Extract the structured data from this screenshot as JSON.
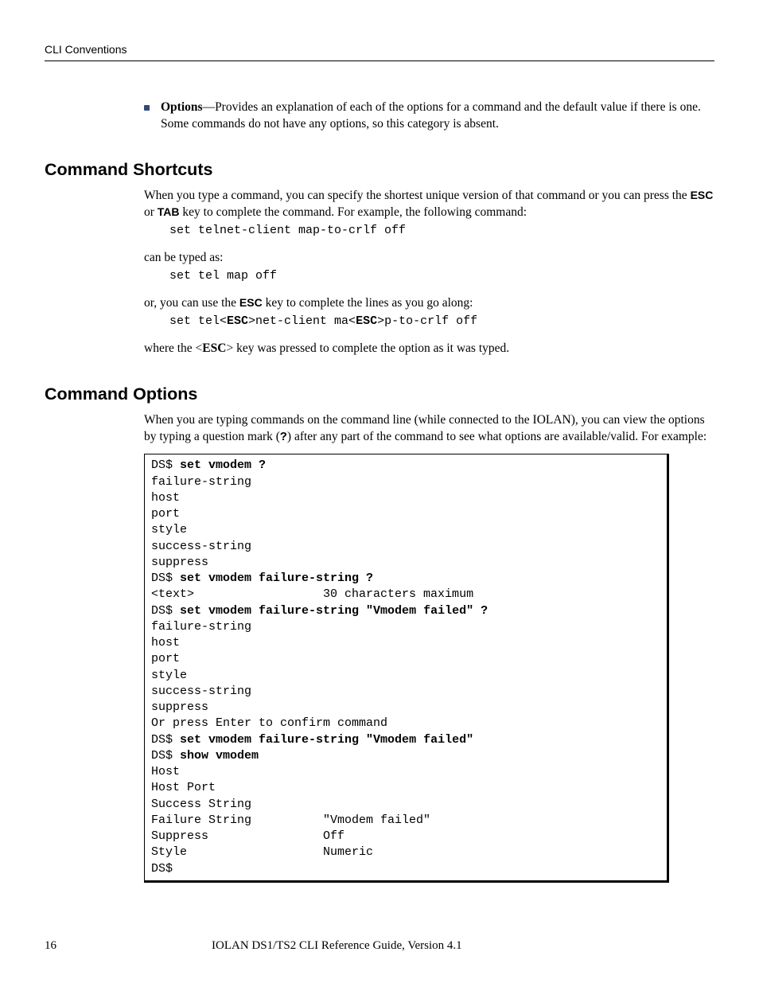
{
  "header": {
    "title": "CLI Conventions"
  },
  "bullet": {
    "label": "Options",
    "text": "—Provides an explanation of each of the options for a command and the default value if there is one. Some commands do not have any options, so this category is absent."
  },
  "section1": {
    "heading": "Command Shortcuts",
    "para1_a": "When you type a command, you can specify the shortest unique version of that command or you can press the ",
    "key_esc": "ESC",
    "para1_b": " or ",
    "key_tab": "TAB",
    "para1_c": " key to complete the command. For example, the following command:",
    "code1": "set telnet-client map-to-crlf off",
    "para2": "can be typed as:",
    "code2": "set tel map off",
    "para3_a": "or, you can use the ",
    "para3_b": " key to complete the lines as you go along:",
    "code3_a": "set tel<",
    "code3_b": ">net-client ma<",
    "code3_c": ">p-to-crlf off",
    "para4_a": "where the <",
    "para4_b": "> key was pressed to complete the option as it was typed.",
    "esc_bold": "ESC"
  },
  "section2": {
    "heading": "Command Options",
    "para_a": "When you are typing commands on the command line (while connected to the IOLAN), you can view the options by typing a question mark (",
    "qmark": "?",
    "para_b": ") after any part of the command to see what options are available/valid. For example:"
  },
  "example": {
    "l01a": "DS$ ",
    "l01b": "set vmodem ?",
    "l02": "failure-string",
    "l03": "host",
    "l04": "port",
    "l05": "style",
    "l06": "success-string",
    "l07": "suppress",
    "l08a": "DS$ ",
    "l08b": "set vmodem failure-string ?",
    "l09": "<text>                  30 characters maximum",
    "l10a": "DS$ ",
    "l10b": "set vmodem failure-string \"Vmodem failed\" ?",
    "l11": "failure-string",
    "l12": "host",
    "l13": "port",
    "l14": "style",
    "l15": "success-string",
    "l16": "suppress",
    "l17": "Or press Enter to confirm command",
    "l18a": "DS$ ",
    "l18b": "set vmodem failure-string \"Vmodem failed\"",
    "l19a": "DS$ ",
    "l19b": "show vmodem",
    "l20": "Host",
    "l21": "Host Port",
    "l22": "Success String",
    "l23": "Failure String          \"Vmodem failed\"",
    "l24": "Suppress                Off",
    "l25": "Style                   Numeric",
    "l26": "DS$"
  },
  "footer": {
    "page": "16",
    "title": "IOLAN DS1/TS2 CLI Reference Guide, Version 4.1"
  }
}
